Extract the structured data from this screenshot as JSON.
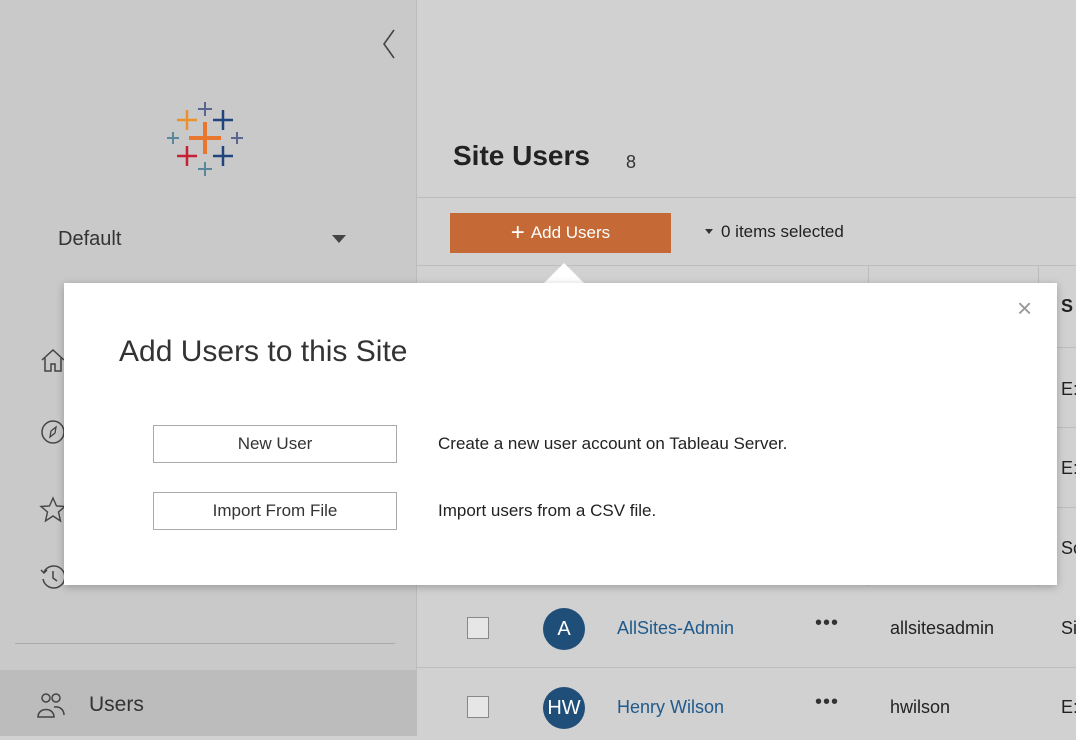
{
  "sidebar": {
    "site_name": "Default",
    "users_label": "Users"
  },
  "main": {
    "title": "Site Users",
    "count": "8",
    "add_users_label": "Add Users",
    "items_selected": "0 items selected",
    "partial_header": "S",
    "rows": [
      {
        "initials": "A",
        "name": "AllSites-Admin",
        "more": "•••",
        "username": "allsitesadmin",
        "role": "Si"
      },
      {
        "initials": "HW",
        "name": "Henry Wilson",
        "more": "•••",
        "username": "hwilson",
        "role": "E:"
      }
    ],
    "hidden_role_cells": [
      "E:",
      "E:",
      "Sc"
    ]
  },
  "popover": {
    "title": "Add Users to this Site",
    "close_symbol": "×",
    "options": [
      {
        "button": "New User",
        "description": "Create a new user account on Tableau Server."
      },
      {
        "button": "Import From File",
        "description": "Import users from a CSV file."
      }
    ]
  },
  "colors": {
    "accent": "#c56a36",
    "avatar": "#1f4e79",
    "link": "#1f5a8c",
    "sidebar_bg": "#c9c9c9"
  }
}
